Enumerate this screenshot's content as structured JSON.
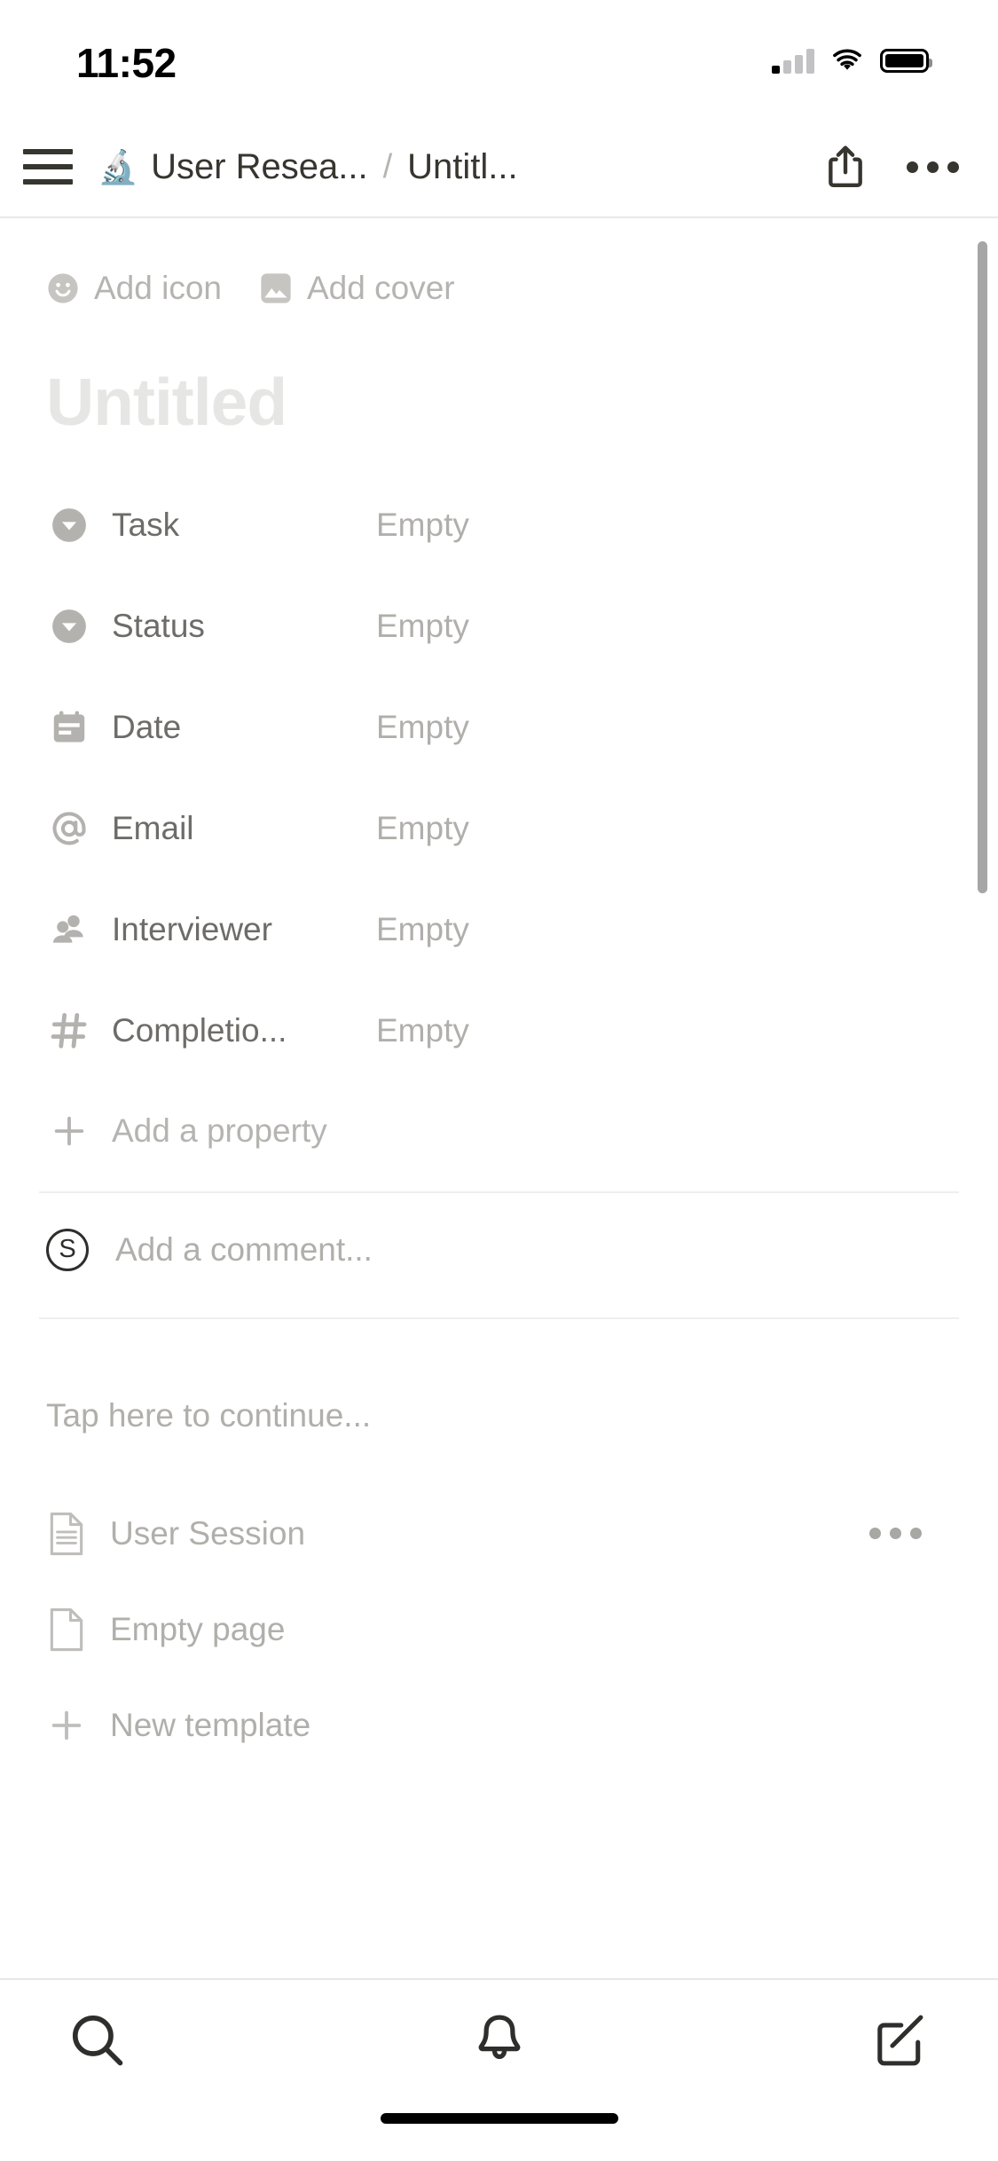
{
  "status_bar": {
    "time": "11:52",
    "cellular_icon": "cellular-signal-icon",
    "wifi_icon": "wifi-icon",
    "battery_icon": "battery-icon"
  },
  "header": {
    "menu_icon": "hamburger-menu-icon",
    "breadcrumb": {
      "emoji": "🔬",
      "parent": "User Resea...",
      "separator": "/",
      "current": "Untitl..."
    },
    "share_icon": "share-icon",
    "more_icon": "more-horizontal-icon"
  },
  "page": {
    "add_icon_label": "Add icon",
    "add_icon_glyph": "smiley-icon",
    "add_cover_label": "Add cover",
    "add_cover_glyph": "image-icon",
    "title_placeholder": "Untitled"
  },
  "properties": [
    {
      "name": "Task",
      "value": "Empty",
      "icon": "select-dropdown-icon"
    },
    {
      "name": "Status",
      "value": "Empty",
      "icon": "select-dropdown-icon"
    },
    {
      "name": "Date",
      "value": "Empty",
      "icon": "calendar-icon"
    },
    {
      "name": "Email",
      "value": "Empty",
      "icon": "at-sign-icon"
    },
    {
      "name": "Interviewer",
      "value": "Empty",
      "icon": "people-icon"
    },
    {
      "name": "Completio...",
      "value": "Empty",
      "icon": "hash-icon"
    }
  ],
  "add_property": {
    "label": "Add a property",
    "icon": "plus-icon"
  },
  "comment": {
    "avatar_initial": "S",
    "placeholder": "Add a comment..."
  },
  "body": {
    "continue_placeholder": "Tap here to continue..."
  },
  "templates": [
    {
      "label": "User Session",
      "icon": "document-lines-icon",
      "has_more": true,
      "more_icon": "more-horizontal-icon"
    },
    {
      "label": "Empty page",
      "icon": "document-blank-icon",
      "has_more": false
    },
    {
      "label": "New template",
      "icon": "plus-icon",
      "has_more": false
    }
  ],
  "tab_bar": {
    "items": [
      {
        "name": "search",
        "icon": "search-icon"
      },
      {
        "name": "notifications",
        "icon": "bell-icon"
      },
      {
        "name": "compose",
        "icon": "compose-icon"
      }
    ]
  },
  "colors": {
    "text_primary": "#37352f",
    "text_secondary": "#6d6c68",
    "text_placeholder": "#b0afab",
    "title_placeholder": "#e6e6e4",
    "divider": "#eeeeec",
    "scrollbar": "#a6a6a6"
  }
}
